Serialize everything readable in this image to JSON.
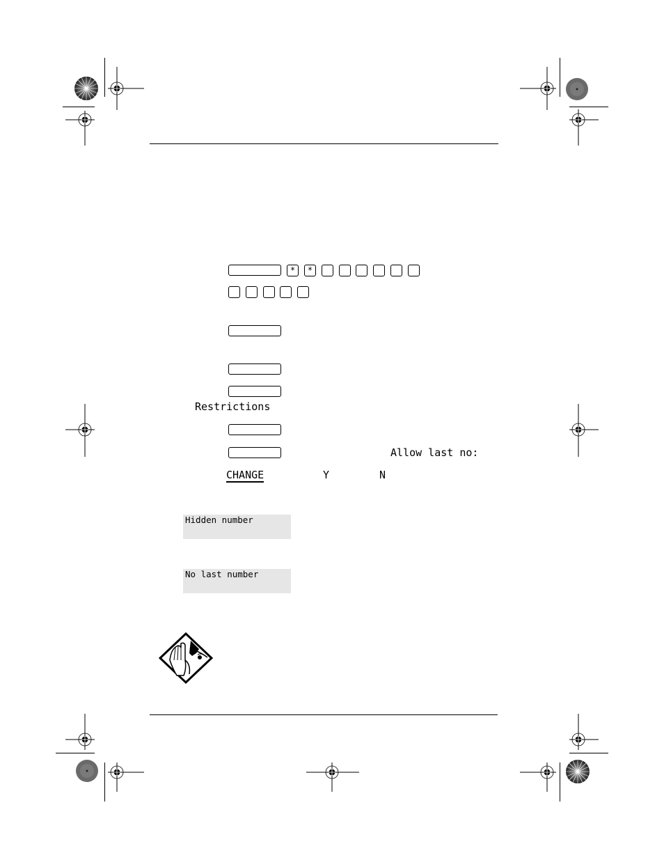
{
  "page": {
    "background": "#ffffff",
    "ink": "#000000"
  },
  "keys": {
    "row1_symbols": [
      "*",
      "*",
      "",
      "",
      "",
      "",
      "",
      ""
    ],
    "row2_count": 5
  },
  "display_text": {
    "restrictions": "Restrictions",
    "allow_last_no": "Allow last no:"
  },
  "softkeys": {
    "change": "CHANGE",
    "yes": "Y",
    "no": "N"
  },
  "lcd_displays": [
    {
      "text": "Hidden number",
      "background": "#e6e6e6"
    },
    {
      "text": "No last number",
      "background": "#e6e6e6"
    }
  ],
  "icons": {
    "tip": "tip-hand-icon",
    "registration_mark": "crosshair-registration-icon",
    "color_target": "starburst-target-icon"
  }
}
